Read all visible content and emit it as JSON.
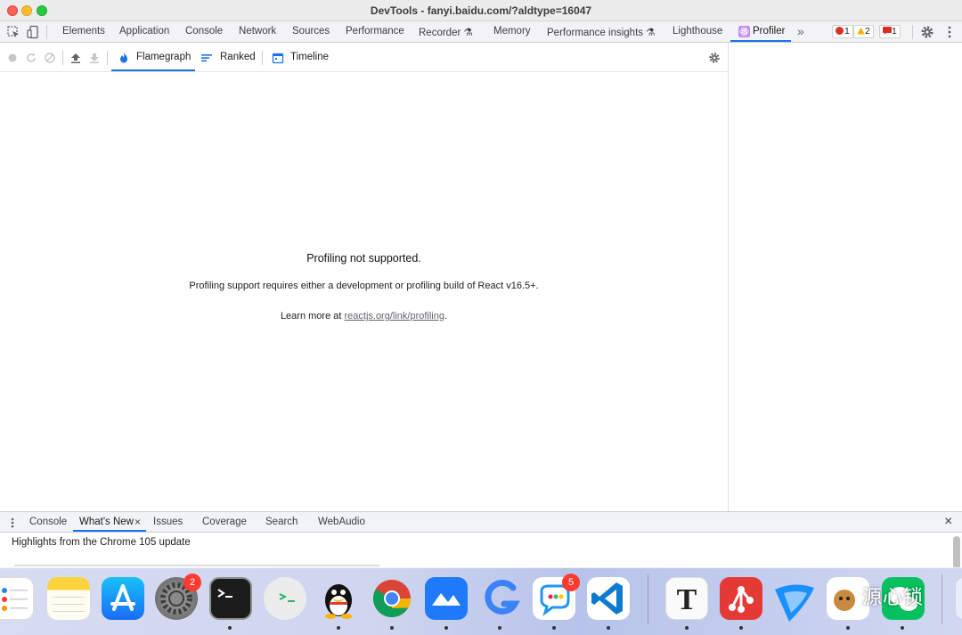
{
  "window": {
    "title": "DevTools - fanyi.baidu.com/?aldtype=16047"
  },
  "main_tabs": [
    {
      "label": "Elements"
    },
    {
      "label": "Application"
    },
    {
      "label": "Console"
    },
    {
      "label": "Network"
    },
    {
      "label": "Sources"
    },
    {
      "label": "Performance"
    },
    {
      "label": "Recorder ⚗"
    },
    {
      "label": "Memory"
    },
    {
      "label": "Performance insights ⚗"
    },
    {
      "label": "Lighthouse"
    },
    {
      "label": "Profiler"
    }
  ],
  "overflow_label": "»",
  "badges": {
    "errors": "1",
    "warnings": "2",
    "issues": "1"
  },
  "profiler": {
    "tabs": {
      "flamegraph": "Flamegraph",
      "ranked": "Ranked",
      "timeline": "Timeline"
    },
    "message_title": "Profiling not supported.",
    "message_body": "Profiling support requires either a development or profiling build of React v16.5+.",
    "learn_more_prefix": "Learn more at ",
    "learn_more_link": "reactjs.org/link/profiling",
    "learn_more_suffix": "."
  },
  "drawer": {
    "tabs": {
      "console": "Console",
      "whats_new": "What's New",
      "issues": "Issues",
      "coverage": "Coverage",
      "search": "Search",
      "webaudio": "WebAudio"
    },
    "close_glyph": "×",
    "highlights": "Highlights from the Chrome 105 update"
  },
  "dock": {
    "settings_badge": "2",
    "messages_badge": "5",
    "typora_letter": "T",
    "watermark": "源心锁"
  },
  "colors": {
    "accent": "#1a73e8",
    "react": "#61dafb",
    "error": "#d93025",
    "warning": "#f9ab00"
  }
}
